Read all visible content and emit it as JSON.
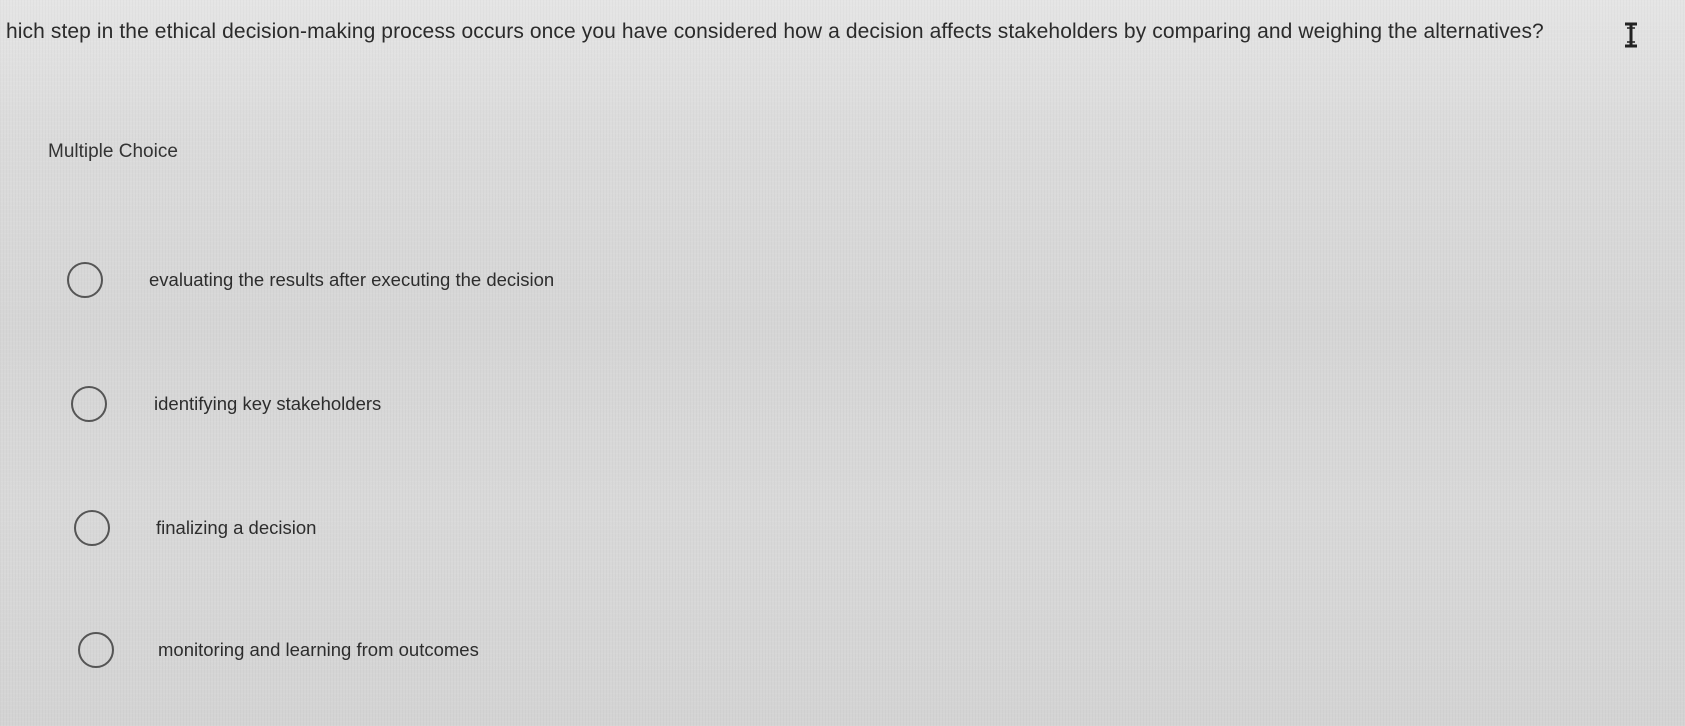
{
  "question": {
    "text": "hich step in the ethical decision-making process occurs once you have considered how a decision affects stakeholders by comparing and weighing the alternatives?"
  },
  "section_label": "Multiple Choice",
  "options": [
    {
      "label": "evaluating the results after executing the decision",
      "selected": false
    },
    {
      "label": "identifying key stakeholders",
      "selected": false
    },
    {
      "label": "finalizing a decision",
      "selected": false
    },
    {
      "label": "monitoring and learning from outcomes",
      "selected": false
    }
  ],
  "icons": {
    "cursor": "text-cursor-icon",
    "radio": "radio-circle-icon"
  }
}
